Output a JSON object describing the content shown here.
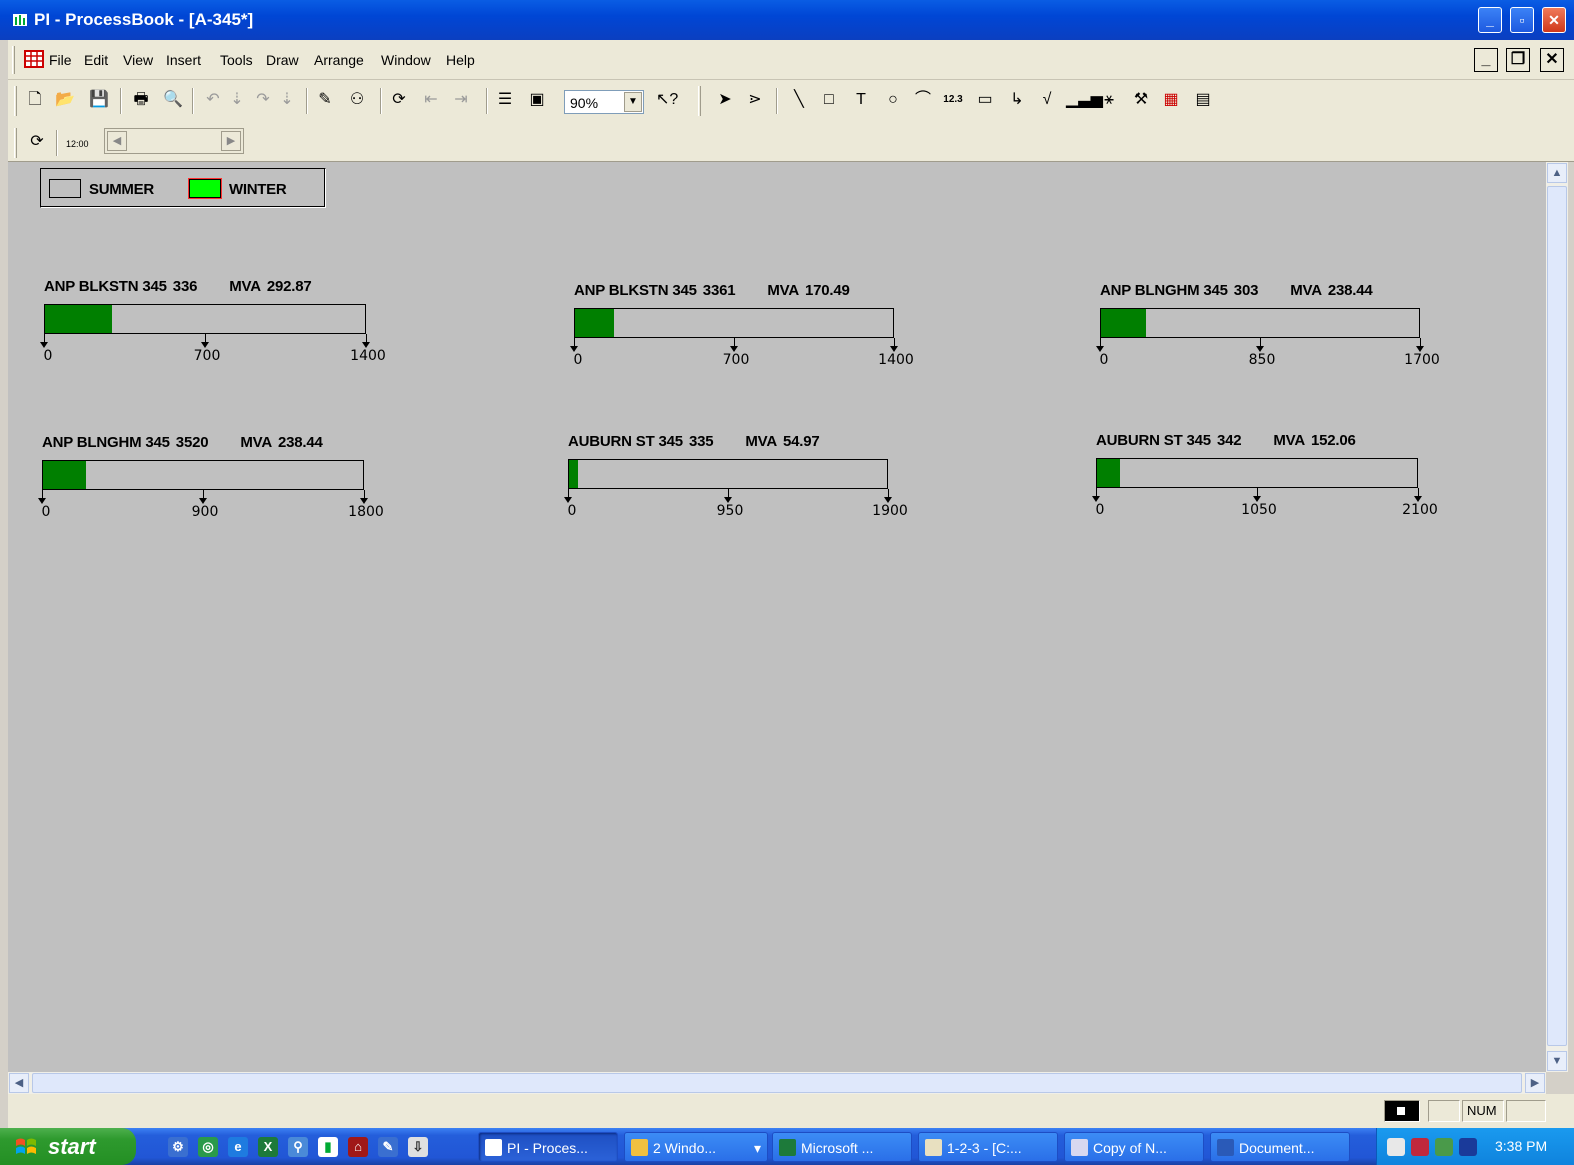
{
  "window": {
    "title": "PI - ProcessBook - [A-345*]"
  },
  "menu": {
    "items": [
      "File",
      "Edit",
      "View",
      "Insert",
      "Tools",
      "Draw",
      "Arrange",
      "Window",
      "Help"
    ]
  },
  "toolbar": {
    "zoom": "90%",
    "number_tool_label": "12.3",
    "time_label": "12:00"
  },
  "legend": {
    "summer_label": "SUMMER",
    "winter_label": "WINTER",
    "summer_color": "#c0c0c0",
    "winter_color": "#00ff00",
    "winter_border": "#ff3030"
  },
  "gauges": [
    {
      "name": "ANP BLKSTN 345",
      "id": "336",
      "unit": "MVA",
      "value": "292.87",
      "value_num": 292.87,
      "max": 1400,
      "ticks": [
        "0",
        "700",
        "1400"
      ]
    },
    {
      "name": "ANP BLKSTN 345",
      "id": "3361",
      "unit": "MVA",
      "value": "170.49",
      "value_num": 170.49,
      "max": 1400,
      "ticks": [
        "0",
        "700",
        "1400"
      ]
    },
    {
      "name": "ANP BLNGHM 345",
      "id": "303",
      "unit": "MVA",
      "value": "238.44",
      "value_num": 238.44,
      "max": 1700,
      "ticks": [
        "0",
        "850",
        "1700"
      ]
    },
    {
      "name": "ANP BLNGHM 345",
      "id": "3520",
      "unit": "MVA",
      "value": "238.44",
      "value_num": 238.44,
      "max": 1800,
      "ticks": [
        "0",
        "900",
        "1800"
      ]
    },
    {
      "name": "AUBURN ST 345",
      "id": "335",
      "unit": "MVA",
      "value": "54.97",
      "value_num": 54.97,
      "max": 1900,
      "ticks": [
        "0",
        "950",
        "1900"
      ]
    },
    {
      "name": "AUBURN ST 345",
      "id": "342",
      "unit": "MVA",
      "value": "152.06",
      "value_num": 152.06,
      "max": 2100,
      "ticks": [
        "0",
        "1050",
        "2100"
      ]
    }
  ],
  "gauge_fill_color": "#007f00",
  "statusbar": {
    "num": "NUM"
  },
  "taskbar": {
    "start_label": "start",
    "tasks": [
      "PI - Proces...",
      "2 Windo...",
      "Microsoft ...",
      "1-2-3 - [C:...",
      "Copy of N...",
      "Document..."
    ],
    "clock": "3:38 PM"
  }
}
